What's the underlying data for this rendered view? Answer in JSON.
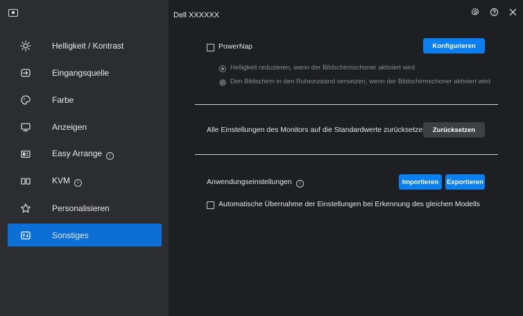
{
  "header": {
    "title": "Dell XXXXXX"
  },
  "sidebar": {
    "items": [
      {
        "label": "Helligkeit / Kontrast",
        "icon": "brightness-icon",
        "info": false,
        "active": false
      },
      {
        "label": "Eingangsquelle",
        "icon": "input-source-icon",
        "info": false,
        "active": false
      },
      {
        "label": "Farbe",
        "icon": "palette-icon",
        "info": false,
        "active": false
      },
      {
        "label": "Anzeigen",
        "icon": "monitor-icon",
        "info": false,
        "active": false
      },
      {
        "label": "Easy Arrange",
        "icon": "easy-arrange-icon",
        "info": true,
        "active": false
      },
      {
        "label": "KVM",
        "icon": "kvm-icon",
        "info": true,
        "active": false
      },
      {
        "label": "Personalisieren",
        "icon": "star-icon",
        "info": false,
        "active": false
      },
      {
        "label": "Sonstiges",
        "icon": "others-icon",
        "info": false,
        "active": true
      }
    ]
  },
  "powernap": {
    "label": "PowerNap",
    "checked": false,
    "configure_label": "Konfigurieren",
    "options": [
      {
        "label": "Helligkeit reduzieren, wenn der Bildschirmschoner aktiviert wird",
        "selected": true
      },
      {
        "label": "Den Bildschirm in den Ruhezustand versetzen, wenn der Bildschirmschoner aktiviert wird",
        "selected": false
      }
    ]
  },
  "reset": {
    "text": "Alle Einstellungen des Monitors auf die Standardwerte zurücksetzen.",
    "button_label": "Zurücksetzen"
  },
  "app_settings": {
    "label": "Anwendungseinstellungen",
    "import_label": "Importieren",
    "export_label": "Exportieren",
    "auto_apply_label": "Automatische Übernahme der Einstellungen bei Erkennung des gleichen Modells",
    "auto_apply_checked": false
  },
  "colors": {
    "accent": "#0a7ff0",
    "sidebar_active": "#0b6fd6",
    "background": "#1e1f22",
    "sidebar": "#2c2d31"
  }
}
